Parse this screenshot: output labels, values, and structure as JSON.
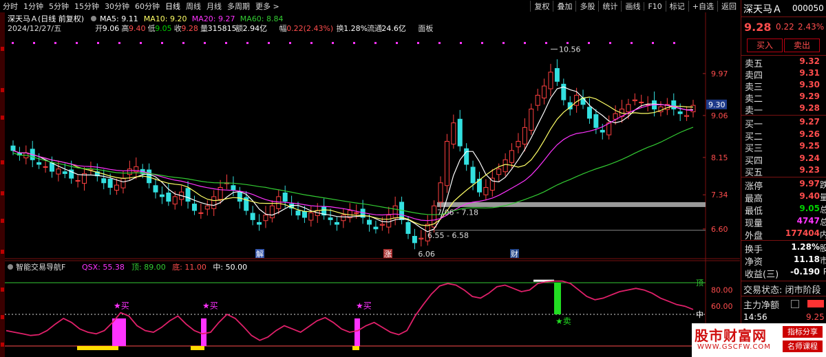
{
  "toolbar": {
    "periods": [
      "分时",
      "1分钟",
      "5分钟",
      "15分钟",
      "30分钟",
      "60分钟",
      "日线",
      "周线",
      "月线",
      "多周期",
      "更多 >"
    ],
    "active_period": "日线",
    "right_buttons": [
      "复权",
      "叠加",
      "多股",
      "统计",
      "画线",
      "F10",
      "标记",
      "+自选",
      "返回"
    ]
  },
  "stock_panel": {
    "name": "深天马Ａ",
    "code": "000050",
    "price": "9.28",
    "change": "0.22",
    "change_pct": "2.43%",
    "buy_label": "买入",
    "sell_label": "卖出",
    "sell_orders": [
      {
        "label": "卖五",
        "price": "9.32"
      },
      {
        "label": "卖四",
        "price": "9.31"
      },
      {
        "label": "卖三",
        "price": "9.30"
      },
      {
        "label": "卖二",
        "price": "9.29"
      },
      {
        "label": "卖一",
        "price": "9.28"
      }
    ],
    "buy_orders": [
      {
        "label": "买一",
        "price": "9.27"
      },
      {
        "label": "买二",
        "price": "9.26"
      },
      {
        "label": "买三",
        "price": "9.25"
      },
      {
        "label": "买四",
        "price": "9.24"
      },
      {
        "label": "买五",
        "price": "9.23"
      }
    ],
    "stats": [
      {
        "label": "涨停",
        "value": "9.97",
        "tail": "跌",
        "color": "#ff4d4d"
      },
      {
        "label": "最高",
        "value": "9.40",
        "tail": "量",
        "color": "#ff4d4d"
      },
      {
        "label": "最低",
        "value": "9.05",
        "tail": "总",
        "color": "#00d000"
      },
      {
        "label": "现量",
        "value": "4747",
        "tail": "总",
        "color": "#ff33ff"
      },
      {
        "label": "外盘",
        "value": "177404",
        "tail": "内",
        "color": "#ff4d4d"
      }
    ],
    "stats2": [
      {
        "label": "换手",
        "value": "1.28%",
        "tail": "股",
        "color": "#ffffff"
      },
      {
        "label": "净资",
        "value": "11.18",
        "tail": "市",
        "color": "#ffffff"
      },
      {
        "label": "收益(三)",
        "value": "-0.190",
        "tail": "P",
        "color": "#ffffff"
      }
    ],
    "trade_state": "交易状态: 闭市阶段",
    "main_net": "主力净额",
    "time_partial": "14:56",
    "price_partial": "9.25"
  },
  "chart_header": {
    "title": "深天马Ａ(日线 前复权)",
    "ma_items": [
      {
        "text": "MA5: 9.11",
        "color": "#ffffff"
      },
      {
        "text": "MA10: 9.20",
        "color": "#ffff66"
      },
      {
        "text": "MA20: 9.27",
        "color": "#ff33ff"
      },
      {
        "text": "MA60: 8.84",
        "color": "#33cc33"
      }
    ],
    "ohlc_items": [
      {
        "text": "2024/12/27/五",
        "color": "#dddddd"
      },
      {
        "text": "开",
        "color": "#dddddd"
      },
      {
        "text": "9.06",
        "color": "#ffffff"
      },
      {
        "text": "高",
        "color": "#dddddd"
      },
      {
        "text": "9.40",
        "color": "#ff4d4d"
      },
      {
        "text": "低",
        "color": "#dddddd"
      },
      {
        "text": "9.05",
        "color": "#00d000"
      },
      {
        "text": "收",
        "color": "#dddddd"
      },
      {
        "text": "9.28",
        "color": "#ff4d4d"
      },
      {
        "text": "量",
        "color": "#dddddd"
      },
      {
        "text": "315815",
        "color": "#ffffff"
      },
      {
        "text": "额",
        "color": "#dddddd"
      },
      {
        "text": "2.94亿",
        "color": "#ffffff"
      },
      {
        "text": "幅",
        "color": "#dddddd"
      },
      {
        "text": "0.22(2.43%)",
        "color": "#ff4d4d"
      },
      {
        "text": "换",
        "color": "#dddddd"
      },
      {
        "text": "1.28%",
        "color": "#ffffff"
      },
      {
        "text": "流通",
        "color": "#dddddd"
      },
      {
        "text": "24.6亿",
        "color": "#ffffff"
      },
      {
        "text": "面板",
        "color": "#dddddd"
      }
    ],
    "price_axis": [
      "9.97",
      "9.06",
      "8.15",
      "7.34",
      "6.60"
    ],
    "current_price_tag": "9.30",
    "annotations": {
      "high": "10.56",
      "low": "6.06",
      "zone_upper": "7.06 - 7.18",
      "zone_lower": "6.55 - 6.58"
    },
    "event_markers": [
      "解",
      "涨",
      "财"
    ]
  },
  "indicator": {
    "title": "智能交易导航F",
    "items": [
      {
        "text": "QSX: 55.38",
        "color": "#ff33ff"
      },
      {
        "text": "顶: 89.00",
        "color": "#33cc33"
      },
      {
        "text": "底: 11.00",
        "color": "#ff4d4d"
      },
      {
        "text": "中: 50.00",
        "color": "#ffffff"
      }
    ],
    "axis": [
      "80.00",
      "60.00"
    ],
    "top_label": "顶",
    "mid_label": "中",
    "buy_signal": "★买",
    "sell_signal": "★卖"
  },
  "watermark": {
    "title": "股市财富网",
    "url": "WWW.GSCFW.COM",
    "tag1": "指标分享",
    "tag2": "名师课程"
  },
  "chart_data": {
    "type": "candlestick",
    "series": [
      {
        "name": "MA5",
        "color": "#ffffff"
      },
      {
        "name": "MA10",
        "color": "#ffff66"
      },
      {
        "name": "MA20",
        "color": "#ff33ff"
      },
      {
        "name": "MA60",
        "color": "#33cc33"
      }
    ],
    "price_range": [
      6.0,
      10.7
    ],
    "close_path": [
      8.3,
      8.2,
      8.25,
      8.1,
      8.0,
      7.95,
      7.85,
      7.9,
      7.8,
      7.7,
      7.65,
      7.8,
      7.9,
      7.75,
      7.6,
      7.5,
      7.55,
      7.7,
      7.9,
      7.95,
      7.8,
      7.6,
      7.4,
      7.3,
      7.2,
      7.3,
      7.4,
      7.2,
      7.0,
      6.95,
      7.1,
      7.3,
      7.5,
      7.6,
      7.45,
      7.2,
      7.0,
      6.8,
      6.7,
      6.9,
      7.1,
      7.3,
      7.2,
      7.05,
      6.9,
      6.85,
      6.95,
      7.0,
      6.9,
      6.8,
      6.7,
      6.9,
      7.0,
      6.95,
      6.85,
      6.7,
      6.6,
      6.7,
      6.9,
      7.1,
      6.8,
      6.5,
      6.3,
      6.4,
      6.7,
      7.1,
      7.6,
      8.5,
      8.9,
      8.4,
      8.0,
      7.6,
      7.4,
      7.5,
      7.7,
      7.9,
      8.1,
      8.3,
      8.5,
      8.8,
      9.2,
      9.5,
      9.7,
      10.0,
      9.8,
      9.4,
      9.2,
      9.5,
      9.3,
      9.0,
      8.8,
      8.7,
      8.9,
      9.1,
      9.2,
      9.3,
      9.4,
      9.35,
      9.3,
      9.2,
      9.25,
      9.3,
      9.2,
      9.1,
      9.06,
      9.28
    ],
    "indicator_path": [
      30,
      28,
      26,
      24,
      25,
      30,
      38,
      45,
      40,
      32,
      28,
      26,
      30,
      40,
      52,
      48,
      36,
      30,
      28,
      34,
      42,
      48,
      38,
      30,
      26,
      28,
      40,
      50,
      45,
      35,
      24,
      18,
      22,
      30,
      36,
      32,
      28,
      35,
      42,
      46,
      40,
      32,
      28,
      30,
      36,
      40,
      34,
      28,
      25,
      30,
      48,
      62,
      75,
      85,
      88,
      86,
      80,
      72,
      70,
      76,
      84,
      86,
      82,
      78,
      80,
      88,
      90,
      91,
      91,
      88,
      80,
      72,
      68,
      70,
      74,
      78,
      80,
      82,
      80,
      76,
      70,
      66,
      62,
      60,
      56
    ]
  }
}
